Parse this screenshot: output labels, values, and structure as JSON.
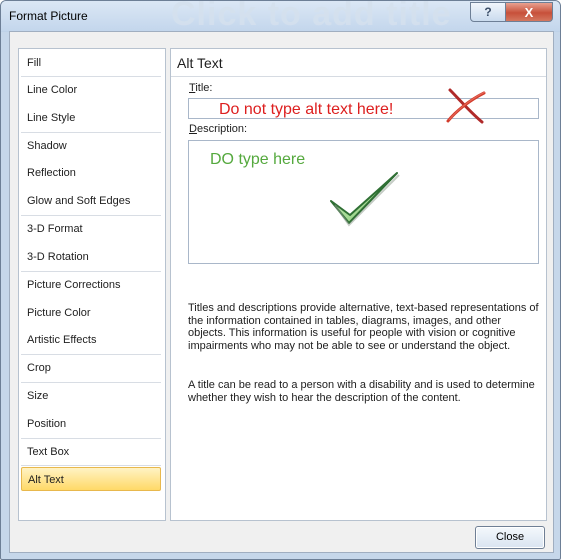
{
  "window": {
    "title": "Format Picture",
    "background_watermark": "Click to add title",
    "help_label": "?",
    "close_label": "X"
  },
  "sidebar": {
    "items": [
      {
        "label": "Fill"
      },
      {
        "label": "Line Color"
      },
      {
        "label": "Line Style"
      },
      {
        "label": "Shadow"
      },
      {
        "label": "Reflection"
      },
      {
        "label": "Glow and Soft Edges"
      },
      {
        "label": "3-D Format"
      },
      {
        "label": "3-D Rotation"
      },
      {
        "label": "Picture Corrections"
      },
      {
        "label": "Picture Color"
      },
      {
        "label": "Artistic Effects"
      },
      {
        "label": "Crop"
      },
      {
        "label": "Size"
      },
      {
        "label": "Position"
      },
      {
        "label": "Text Box"
      },
      {
        "label": "Alt Text"
      }
    ],
    "selected": "Alt Text"
  },
  "panel": {
    "heading": "Alt Text",
    "title_label_mnemonic": "T",
    "title_label_rest": "itle:",
    "title_value": "Do not type alt text here!",
    "description_label_mnemonic": "D",
    "description_label_rest": "escription:",
    "description_value": "DO type here",
    "help_paragraph_1": "Titles and descriptions provide alternative, text-based representations of the information contained in tables, diagrams, images, and other objects. This information is useful for people with vision or cognitive impairments who may not be able to see or understand the object.",
    "help_paragraph_2": "A title can be read to a person with a disability and is used to determine whether they wish to hear the description of the content."
  },
  "footer": {
    "close_label": "Close"
  },
  "colors": {
    "warning_text": "#dd1f1f",
    "ok_text": "#55a93e",
    "selected_item": "#ffd968"
  },
  "annotations": {
    "cross_icon": "red-x-mark",
    "check_icon": "green-check-mark"
  }
}
